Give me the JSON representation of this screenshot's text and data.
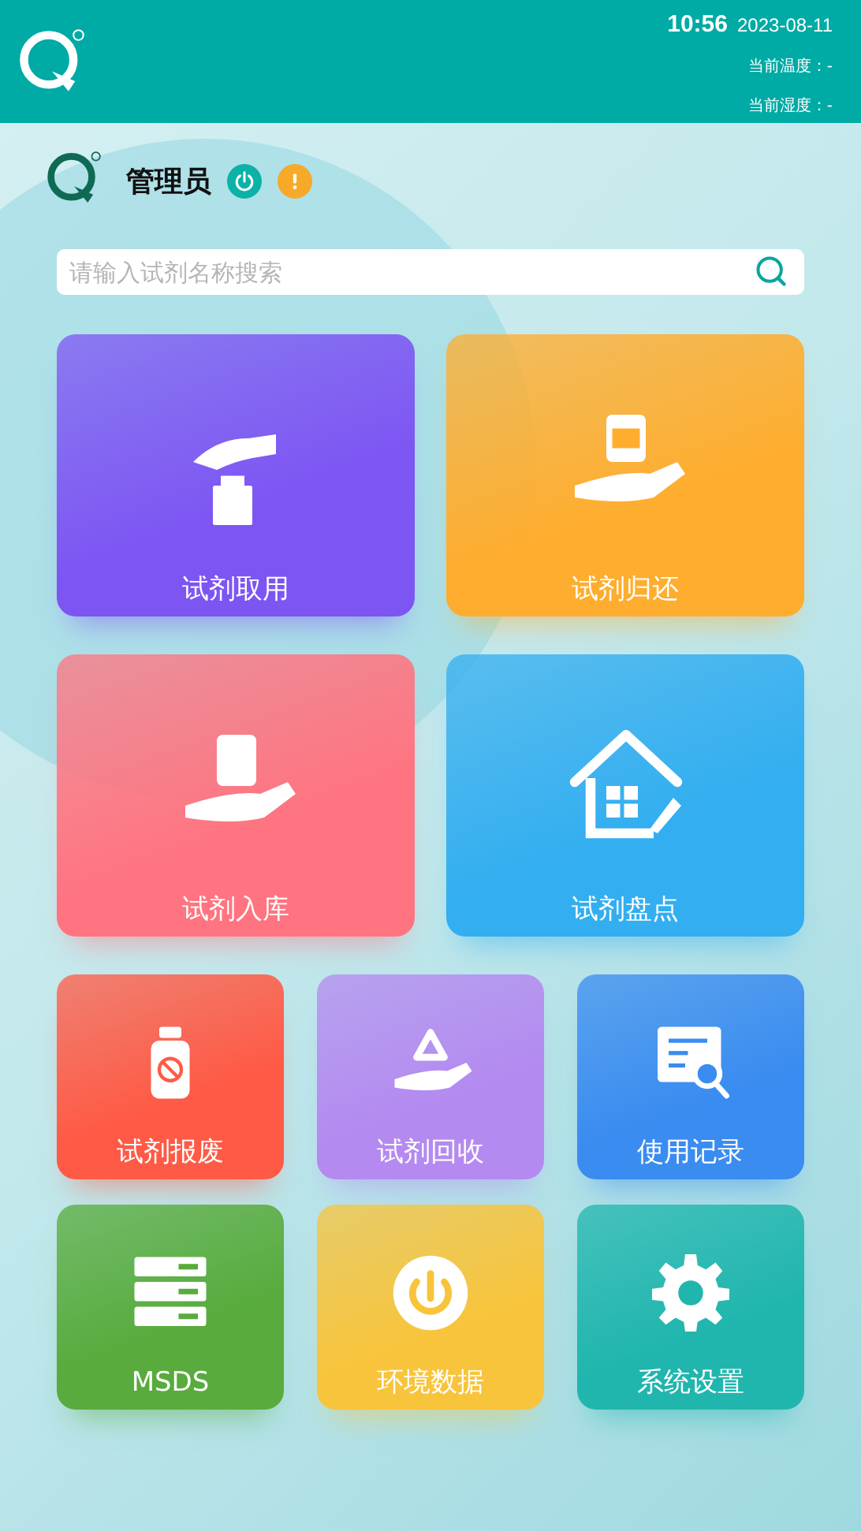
{
  "header": {
    "time": "10:56",
    "date": "2023-08-11",
    "temperature": "当前温度：-",
    "humidity": "当前湿度：-"
  },
  "user": {
    "name": "管理员"
  },
  "search": {
    "placeholder": "请输入试剂名称搜索"
  },
  "tiles": [
    {
      "kind": "large",
      "label": "试剂取用",
      "color": "#7d55f3"
    },
    {
      "kind": "large",
      "label": "试剂归还",
      "color": "#ffad2e"
    },
    {
      "kind": "large",
      "label": "试剂入库",
      "color": "#ff7480"
    },
    {
      "kind": "large",
      "label": "试剂盘点",
      "color": "#33aef0"
    },
    {
      "kind": "small",
      "label": "试剂报废",
      "color": "#ff5a45"
    },
    {
      "kind": "small",
      "label": "试剂回收",
      "color": "#b48af0"
    },
    {
      "kind": "small",
      "label": "使用记录",
      "color": "#3a8cf0"
    },
    {
      "kind": "small",
      "label": "MSDS",
      "color": "#58ab3c"
    },
    {
      "kind": "small",
      "label": "环境数据",
      "color": "#f8c43c"
    },
    {
      "kind": "small",
      "label": "系统设置",
      "color": "#20b6ae"
    }
  ]
}
